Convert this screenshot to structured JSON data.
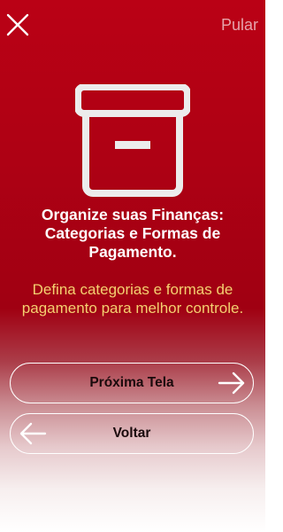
{
  "header": {
    "close_icon": "close-icon",
    "skip_label": "Pular"
  },
  "hero": {
    "icon": "archive-box-icon"
  },
  "content": {
    "title": "Organize suas Finanças: Categorias e Formas de Pagamento.",
    "subtitle": "Defina categorias e formas de pagamento para melhor controle."
  },
  "buttons": {
    "next_label": "Próxima Tela",
    "next_icon": "arrow-right-icon",
    "back_label": "Voltar",
    "back_icon": "arrow-left-icon"
  },
  "colors": {
    "background_top": "#ba0115",
    "background_bottom": "#ffffff",
    "subtitle": "#f4d070",
    "skip_link": "#e6a3aa",
    "icon": "#ececec"
  }
}
